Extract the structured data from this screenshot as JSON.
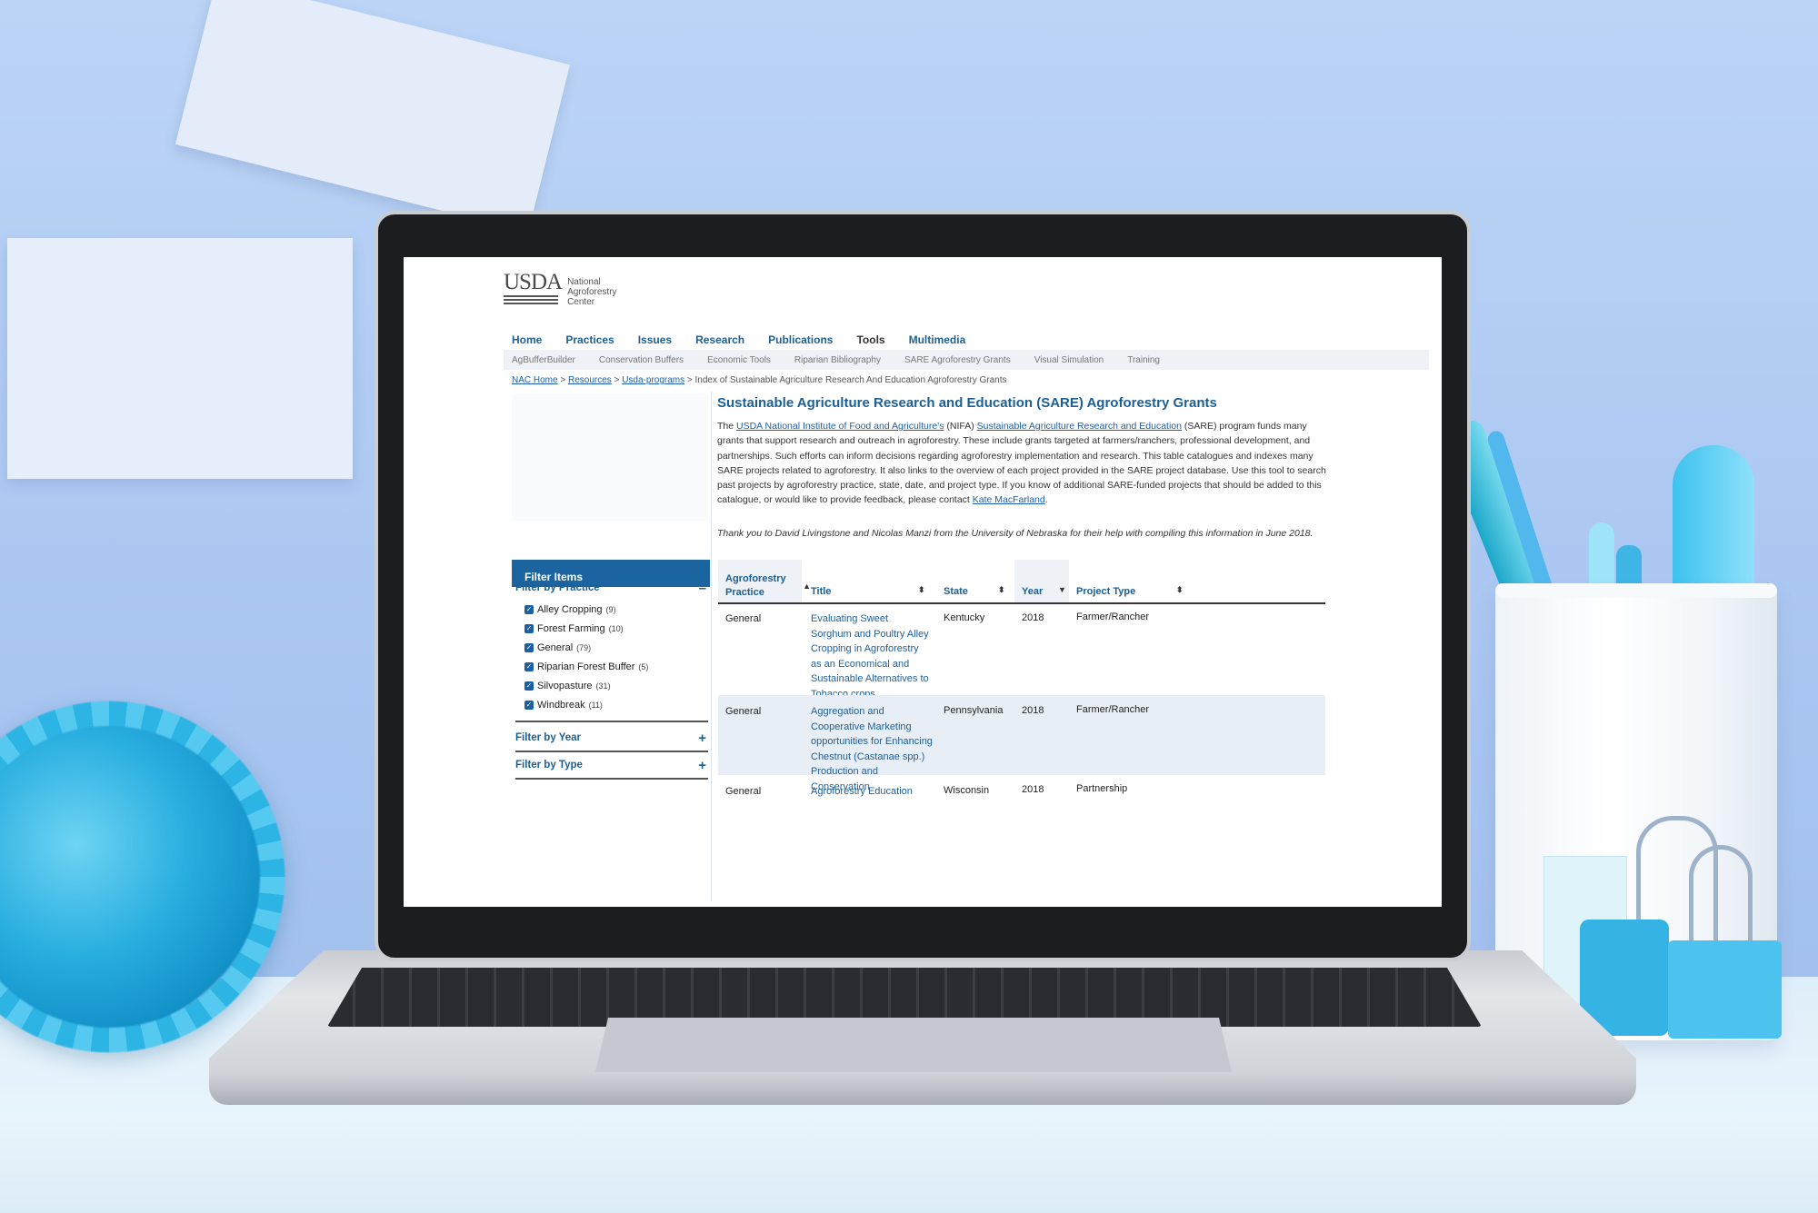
{
  "site": {
    "logo": {
      "mark": "USDA",
      "line1": "National",
      "line2": "Agroforestry",
      "line3": "Center"
    },
    "main_nav": [
      "Home",
      "Practices",
      "Issues",
      "Research",
      "Publications",
      "Tools",
      "Multimedia"
    ],
    "active_nav": "Tools",
    "sub_nav": [
      "AgBufferBuilder",
      "Conservation Buffers",
      "Economic Tools",
      "Riparian Bibliography",
      "SARE Agroforestry Grants",
      "Visual Simulation",
      "Training"
    ],
    "breadcrumb": {
      "items": [
        "NAC Home",
        "Resources",
        "Usda-programs"
      ],
      "sep": ">",
      "current": "Index of Sustainable Agriculture Research And Education Agroforestry Grants"
    },
    "page_title": "Sustainable Agriculture Research and Education (SARE) Agroforestry Grants",
    "intro": {
      "t1": "The ",
      "link1": "USDA National Institute of Food and Agriculture's",
      "t2": " (NIFA) ",
      "link2": "Sustainable Agriculture Research and Education",
      "t3": " (SARE) program funds many grants that support research and outreach in agroforestry. These include grants targeted at farmers/ranchers, professional development, and partnerships. Such efforts can inform decisions regarding agroforestry implementation and research. This table catalogues and indexes many SARE projects related to agroforestry. It also links to the overview of each project provided in the SARE project database. Use this tool to search past projects by agroforestry practice, state, date, and project type. If you know of additional SARE-funded projects that should be added to this catalogue, or would like to provide feedback, please contact ",
      "link3": "Kate MacFarland",
      "t4": "."
    },
    "thanks": "Thank you to David Livingstone and Nicolas Manzi from the University of Nebraska for their help with compiling this information in June 2018.",
    "filters": {
      "heading": "Filter Items",
      "practice_label": "Filter by Practice",
      "practice_toggle": "–",
      "practices": [
        {
          "label": "Alley Cropping",
          "count": "(9)"
        },
        {
          "label": "Forest Farming",
          "count": "(10)"
        },
        {
          "label": "General",
          "count": "(79)"
        },
        {
          "label": "Riparian Forest Buffer",
          "count": "(5)"
        },
        {
          "label": "Silvopasture",
          "count": "(31)"
        },
        {
          "label": "Windbreak",
          "count": "(11)"
        }
      ],
      "year_label": "Filter by Year",
      "type_label": "Filter by Type",
      "expand_symbol": "+"
    },
    "table": {
      "headers": [
        "Agroforestry Practice",
        "Title",
        "State",
        "Year",
        "Project Type"
      ],
      "rows": [
        {
          "practice": "General",
          "title": "Evaluating Sweet Sorghum and Poultry Alley Cropping in Agroforestry as an Economical and Sustainable Alternatives to Tobacco crops",
          "state": "Kentucky",
          "year": "2018",
          "type": "Farmer/Rancher"
        },
        {
          "practice": "General",
          "title": "Aggregation and Cooperative Marketing opportunities for Enhancing Chestnut (Castanae spp.) Production and Conservation",
          "state": "Pennsylvania",
          "year": "2018",
          "type": "Farmer/Rancher"
        },
        {
          "practice": "General",
          "title": "Agroforestry Education",
          "state": "Wisconsin",
          "year": "2018",
          "type": "Partnership"
        }
      ]
    }
  }
}
